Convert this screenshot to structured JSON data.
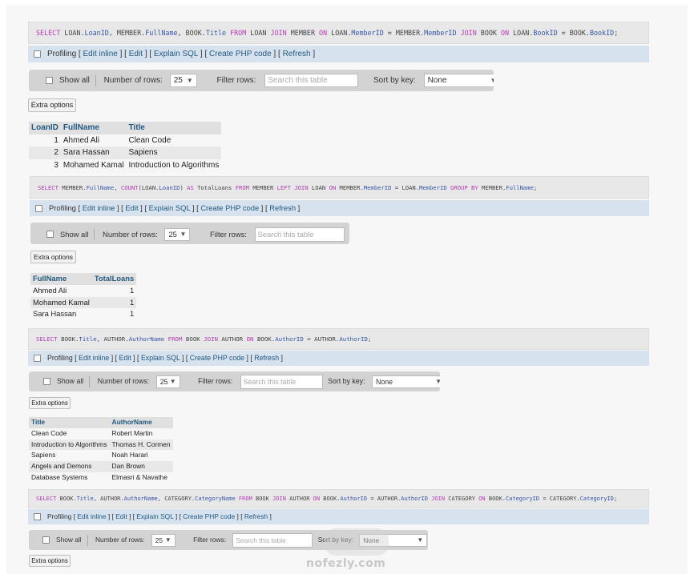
{
  "blocks": [
    {
      "sql_parts": [
        {
          "t": "SELECT",
          "c": "kw"
        },
        {
          "t": " LOAN."
        },
        {
          "t": "LoanID",
          "c": "fn"
        },
        {
          "t": ", MEMBER."
        },
        {
          "t": "FullName",
          "c": "fn"
        },
        {
          "t": ", BOOK."
        },
        {
          "t": "Title",
          "c": "fn"
        },
        {
          "t": " "
        },
        {
          "t": "FROM",
          "c": "kw"
        },
        {
          "t": " LOAN "
        },
        {
          "t": "JOIN",
          "c": "kw"
        },
        {
          "t": " MEMBER "
        },
        {
          "t": "ON",
          "c": "kw"
        },
        {
          "t": " LOAN."
        },
        {
          "t": "MemberID",
          "c": "fn"
        },
        {
          "t": " = MEMBER."
        },
        {
          "t": "MemberID",
          "c": "fn"
        },
        {
          "t": " "
        },
        {
          "t": "JOIN",
          "c": "kw"
        },
        {
          "t": " BOOK "
        },
        {
          "t": "ON",
          "c": "kw"
        },
        {
          "t": " LOAN."
        },
        {
          "t": "BookID",
          "c": "fn"
        },
        {
          "t": " = BOOK."
        },
        {
          "t": "BookID",
          "c": "fn"
        },
        {
          "t": ";"
        }
      ],
      "profiling": "Profiling",
      "links": [
        "Edit inline",
        "Edit",
        "Explain SQL",
        "Create PHP code",
        "Refresh"
      ],
      "show_all": "Show all",
      "rows_label": "Number of rows:",
      "rows_value": "25",
      "filter_label": "Filter rows:",
      "filter_placeholder": "Search this table",
      "sort_label": "Sort by key:",
      "sort_value": "None",
      "extra_options": "Extra options",
      "columns": [
        "LoanID",
        "FullName",
        "Title"
      ],
      "rows": [
        [
          "1",
          "Ahmed Ali",
          "Clean Code"
        ],
        [
          "2",
          "Sara Hassan",
          "Sapiens"
        ],
        [
          "3",
          "Mohamed Kamal",
          "Introduction to Algorithms"
        ]
      ]
    },
    {
      "sql_parts": [
        {
          "t": "SELECT",
          "c": "kw"
        },
        {
          "t": " MEMBER."
        },
        {
          "t": "FullName",
          "c": "fn"
        },
        {
          "t": ", "
        },
        {
          "t": "COUNT",
          "c": "kw"
        },
        {
          "t": "(LOAN."
        },
        {
          "t": "LoanID",
          "c": "fn"
        },
        {
          "t": ") "
        },
        {
          "t": "AS",
          "c": "kw"
        },
        {
          "t": " TotalLoans "
        },
        {
          "t": "FROM",
          "c": "kw"
        },
        {
          "t": " MEMBER "
        },
        {
          "t": "LEFT",
          "c": "kw"
        },
        {
          "t": " "
        },
        {
          "t": "JOIN",
          "c": "kw"
        },
        {
          "t": " LOAN "
        },
        {
          "t": "ON",
          "c": "kw"
        },
        {
          "t": " MEMBER."
        },
        {
          "t": "MemberID",
          "c": "fn"
        },
        {
          "t": " = LOAN."
        },
        {
          "t": "MemberID",
          "c": "fn"
        },
        {
          "t": " "
        },
        {
          "t": "GROUP BY",
          "c": "kw"
        },
        {
          "t": " MEMBER."
        },
        {
          "t": "FullName",
          "c": "fn"
        },
        {
          "t": ";"
        }
      ],
      "profiling": "Profiling",
      "links": [
        "Edit inline",
        "Edit",
        "Explain SQL",
        "Create PHP code",
        "Refresh"
      ],
      "show_all": "Show all",
      "rows_label": "Number of rows:",
      "rows_value": "25",
      "filter_label": "Filter rows:",
      "filter_placeholder": "Search this table",
      "extra_options": "Extra options",
      "columns": [
        "FullName",
        "TotalLoans"
      ],
      "rows": [
        [
          "Ahmed Ali",
          "1"
        ],
        [
          "Mohamed Kamal",
          "1"
        ],
        [
          "Sara Hassan",
          "1"
        ]
      ]
    },
    {
      "sql_parts": [
        {
          "t": "SELECT",
          "c": "kw"
        },
        {
          "t": " BOOK."
        },
        {
          "t": "Title",
          "c": "fn"
        },
        {
          "t": ", AUTHOR."
        },
        {
          "t": "AuthorName",
          "c": "fn"
        },
        {
          "t": " "
        },
        {
          "t": "FROM",
          "c": "kw"
        },
        {
          "t": " BOOK "
        },
        {
          "t": "JOIN",
          "c": "kw"
        },
        {
          "t": " AUTHOR "
        },
        {
          "t": "ON",
          "c": "kw"
        },
        {
          "t": " BOOK."
        },
        {
          "t": "AuthorID",
          "c": "fn"
        },
        {
          "t": " = AUTHOR."
        },
        {
          "t": "AuthorID",
          "c": "fn"
        },
        {
          "t": ";"
        }
      ],
      "profiling": "Profiling",
      "links": [
        "Edit inline",
        "Edit",
        "Explain SQL",
        "Create PHP code",
        "Refresh"
      ],
      "show_all": "Show all",
      "rows_label": "Number of rows:",
      "rows_value": "25",
      "filter_label": "Filter rows:",
      "filter_placeholder": "Search this table",
      "sort_label": "Sort by key:",
      "sort_value": "None",
      "extra_options": "Extra options",
      "columns": [
        "Title",
        "AuthorName"
      ],
      "rows": [
        [
          "Clean Code",
          "Robert Martin"
        ],
        [
          "Introduction to Algorithms",
          "Thomas H. Cormen"
        ],
        [
          "Sapiens",
          "Noah Harari"
        ],
        [
          "Angels and Demons",
          "Dan Brown"
        ],
        [
          "Database Systems",
          "Elmasri & Navathe"
        ]
      ]
    },
    {
      "sql_parts": [
        {
          "t": "SELECT",
          "c": "kw"
        },
        {
          "t": " BOOK."
        },
        {
          "t": "Title",
          "c": "fn"
        },
        {
          "t": ", AUTHOR."
        },
        {
          "t": "AuthorName",
          "c": "fn"
        },
        {
          "t": ", CATEGORY."
        },
        {
          "t": "CategoryName",
          "c": "fn"
        },
        {
          "t": " "
        },
        {
          "t": "FROM",
          "c": "kw"
        },
        {
          "t": " BOOK "
        },
        {
          "t": "JOIN",
          "c": "kw"
        },
        {
          "t": " AUTHOR "
        },
        {
          "t": "ON",
          "c": "kw"
        },
        {
          "t": " BOOK."
        },
        {
          "t": "AuthorID",
          "c": "fn"
        },
        {
          "t": " = AUTHOR."
        },
        {
          "t": "AuthorID",
          "c": "fn"
        },
        {
          "t": " "
        },
        {
          "t": "JOIN",
          "c": "kw"
        },
        {
          "t": " CATEGORY "
        },
        {
          "t": "ON",
          "c": "kw"
        },
        {
          "t": " BOOK."
        },
        {
          "t": "CategoryID",
          "c": "fn"
        },
        {
          "t": " = CATEGORY."
        },
        {
          "t": "CategoryID",
          "c": "fn"
        },
        {
          "t": ";"
        }
      ],
      "profiling": "Profiling",
      "links": [
        "Edit inline",
        "Edit",
        "Explain SQL",
        "Create PHP code",
        "Refresh"
      ],
      "show_all": "Show all",
      "rows_label": "Number of rows:",
      "rows_value": "25",
      "filter_label": "Filter rows:",
      "filter_placeholder": "Search this table",
      "sort_label": "Sort by key:",
      "sort_value": "None",
      "extra_options": "Extra options"
    }
  ],
  "watermark": "nofezly.com"
}
